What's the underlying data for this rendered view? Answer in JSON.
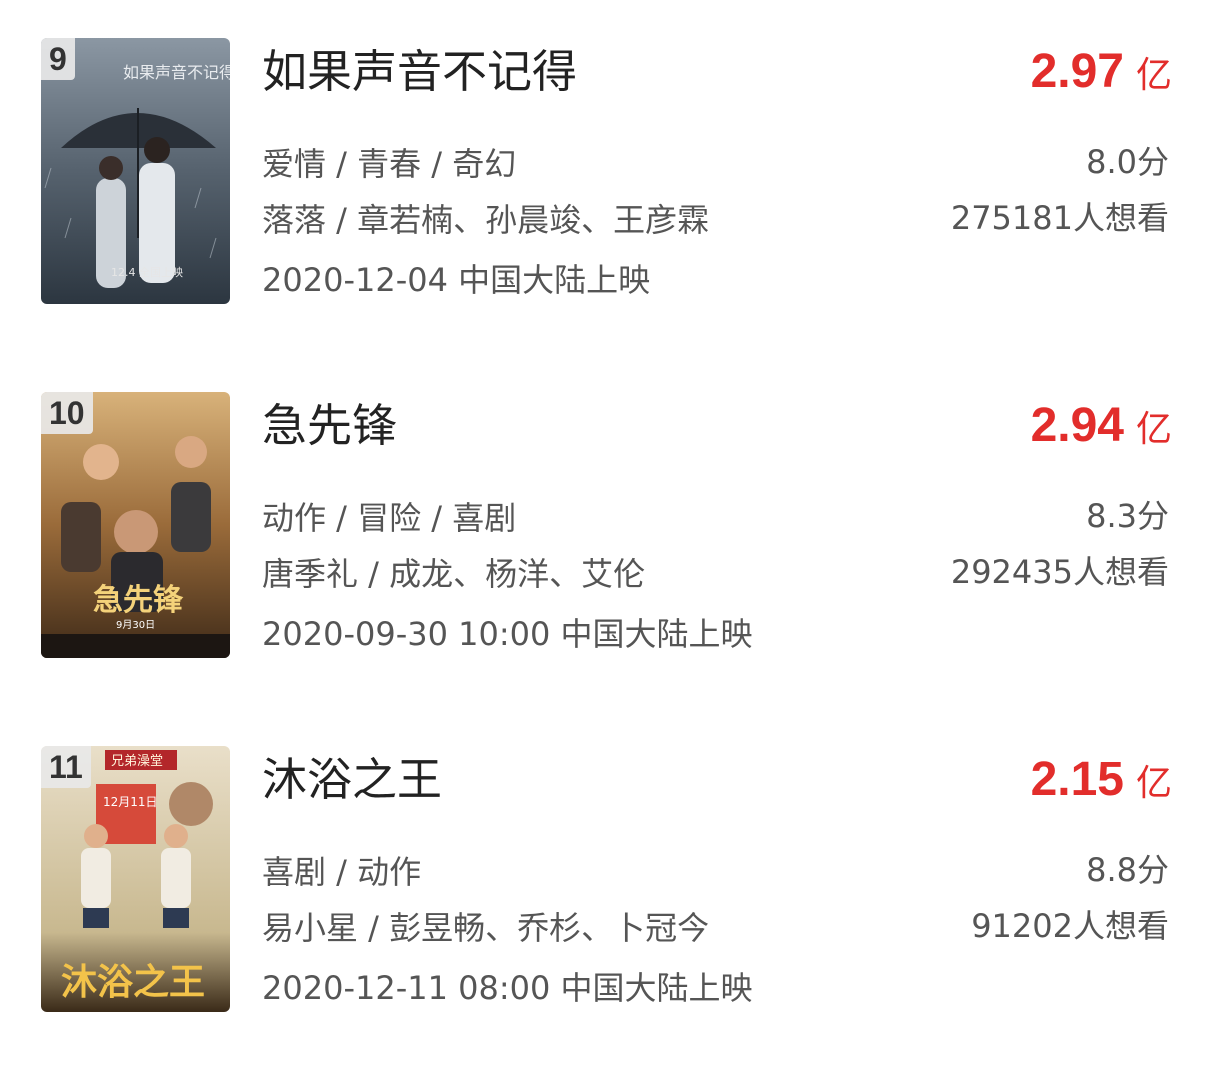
{
  "movies": [
    {
      "rank": "9",
      "title": "如果声音不记得",
      "box_office": "2.97",
      "box_unit": "亿",
      "genre": "爱情 / 青春 / 奇幻",
      "cast": "落落 / 章若楠、孙晨竣、王彦霖",
      "release": "2020-12-04 中国大陆上映",
      "rating": "8.0分",
      "want": "275181人想看",
      "poster_text": "如果声音不记得",
      "poster_date": "12.4 全国上映"
    },
    {
      "rank": "10",
      "title": "急先锋",
      "box_office": "2.94",
      "box_unit": "亿",
      "genre": "动作 / 冒险 / 喜剧",
      "cast": "唐季礼 / 成龙、杨洋、艾伦",
      "release": "2020-09-30 10:00 中国大陆上映",
      "rating": "8.3分",
      "want": "292435人想看",
      "poster_text": "急先锋",
      "poster_date": "9月30日"
    },
    {
      "rank": "11",
      "title": "沐浴之王",
      "box_office": "2.15",
      "box_unit": "亿",
      "genre": "喜剧 / 动作",
      "cast": "易小星 / 彭昱畅、乔杉、卜冠今",
      "release": "2020-12-11 08:00 中国大陆上映",
      "rating": "8.8分",
      "want": "91202人想看",
      "poster_text": "沐浴之王",
      "poster_sign": "兄弟澡堂",
      "poster_date": "12月11日"
    }
  ],
  "colors": {
    "box_office": "#e22d2b",
    "text": "#555555",
    "title": "#222222"
  }
}
